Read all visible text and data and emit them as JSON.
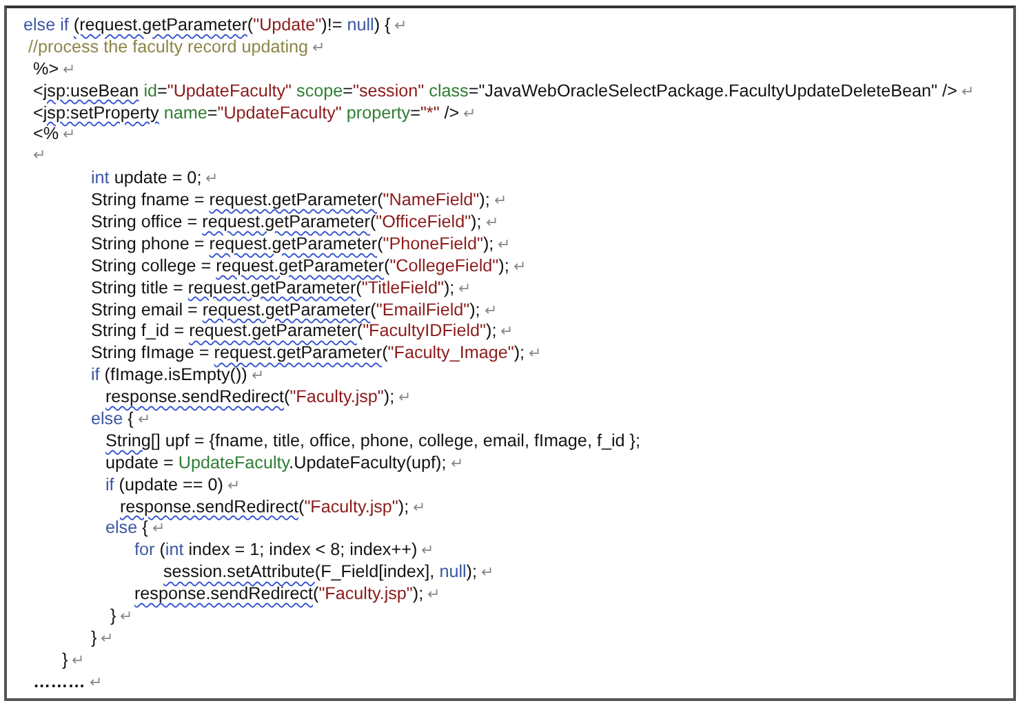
{
  "document": {
    "lines": [
      {
        "tokens": [
          {
            "text": "else if ",
            "kind": "keyword"
          },
          {
            "text": "(request.getParameter",
            "kind": "misspelled"
          },
          {
            "text": "(",
            "kind": "plain"
          },
          {
            "text": "\"Update\"",
            "kind": "string"
          },
          {
            "text": ")!= ",
            "kind": "plain"
          },
          {
            "text": "null",
            "kind": "keyword"
          },
          {
            "text": ") {",
            "kind": "plain"
          }
        ],
        "mark": "↵"
      },
      {
        "tokens": [
          {
            "text": " //process the faculty record updating",
            "kind": "comment"
          }
        ],
        "mark": "↵"
      },
      {
        "tokens": [
          {
            "text": "  %>",
            "kind": "plain"
          }
        ],
        "mark": "↵"
      },
      {
        "tokens": [
          {
            "text": "  <",
            "kind": "plain"
          },
          {
            "text": "jsp:useBean",
            "kind": "misspelled"
          },
          {
            "text": " id",
            "kind": "attr"
          },
          {
            "text": "=",
            "kind": "plain"
          },
          {
            "text": "\"UpdateFaculty\"",
            "kind": "string"
          },
          {
            "text": " scope",
            "kind": "attr"
          },
          {
            "text": "=",
            "kind": "plain"
          },
          {
            "text": "\"session\"",
            "kind": "string"
          },
          {
            "text": " class",
            "kind": "attr"
          },
          {
            "text": "=\"JavaWebOracleSelectPackage.FacultyUpdateDeleteBean\" />",
            "kind": "plain"
          }
        ],
        "mark": "↵"
      },
      {
        "tokens": [
          {
            "text": "  <",
            "kind": "plain"
          },
          {
            "text": "jsp:setProperty",
            "kind": "misspelled"
          },
          {
            "text": " name",
            "kind": "attr"
          },
          {
            "text": "=",
            "kind": "plain"
          },
          {
            "text": "\"UpdateFaculty\"",
            "kind": "string"
          },
          {
            "text": " property",
            "kind": "attr"
          },
          {
            "text": "=",
            "kind": "plain"
          },
          {
            "text": "\"*\"",
            "kind": "string"
          },
          {
            "text": " />",
            "kind": "plain"
          }
        ],
        "mark": "↵"
      },
      {
        "tokens": [
          {
            "text": "  <%",
            "kind": "plain"
          }
        ],
        "mark": "↵"
      },
      {
        "mark": "↵"
      },
      {
        "tokens": [
          {
            "text": "              int",
            "kind": "keyword"
          },
          {
            "text": " update = 0;",
            "kind": "plain"
          }
        ],
        "mark": "↵"
      },
      {
        "tokens": [
          {
            "text": "              String fname = ",
            "kind": "plain"
          },
          {
            "text": "request.getParameter",
            "kind": "misspelled"
          },
          {
            "text": "(",
            "kind": "plain"
          },
          {
            "text": "\"NameField\"",
            "kind": "string"
          },
          {
            "text": ");",
            "kind": "plain"
          }
        ],
        "mark": "↵"
      },
      {
        "tokens": [
          {
            "text": "              String office = ",
            "kind": "plain"
          },
          {
            "text": "request.getParameter",
            "kind": "misspelled"
          },
          {
            "text": "(",
            "kind": "plain"
          },
          {
            "text": "\"OfficeField\"",
            "kind": "string"
          },
          {
            "text": ");",
            "kind": "plain"
          }
        ],
        "mark": "↵"
      },
      {
        "tokens": [
          {
            "text": "              String phone = ",
            "kind": "plain"
          },
          {
            "text": "request.getParameter",
            "kind": "misspelled"
          },
          {
            "text": "(",
            "kind": "plain"
          },
          {
            "text": "\"PhoneField\"",
            "kind": "string"
          },
          {
            "text": ");",
            "kind": "plain"
          }
        ],
        "mark": "↵"
      },
      {
        "tokens": [
          {
            "text": "              String college = ",
            "kind": "plain"
          },
          {
            "text": "request.getParameter",
            "kind": "misspelled"
          },
          {
            "text": "(",
            "kind": "plain"
          },
          {
            "text": "\"CollegeField\"",
            "kind": "string"
          },
          {
            "text": ");",
            "kind": "plain"
          }
        ],
        "mark": "↵"
      },
      {
        "tokens": [
          {
            "text": "              String title = ",
            "kind": "plain"
          },
          {
            "text": "request.getParameter",
            "kind": "misspelled"
          },
          {
            "text": "(",
            "kind": "plain"
          },
          {
            "text": "\"TitleField\"",
            "kind": "string"
          },
          {
            "text": ");",
            "kind": "plain"
          }
        ],
        "mark": "↵"
      },
      {
        "tokens": [
          {
            "text": "              String email = ",
            "kind": "plain"
          },
          {
            "text": "request.getParameter",
            "kind": "misspelled"
          },
          {
            "text": "(",
            "kind": "plain"
          },
          {
            "text": "\"EmailField\"",
            "kind": "string"
          },
          {
            "text": ");",
            "kind": "plain"
          }
        ],
        "mark": "↵"
      },
      {
        "tokens": [
          {
            "text": "              String f_id = ",
            "kind": "plain"
          },
          {
            "text": "request.getParameter",
            "kind": "misspelled"
          },
          {
            "text": "(",
            "kind": "plain"
          },
          {
            "text": "\"FacultyIDField\"",
            "kind": "string"
          },
          {
            "text": ");",
            "kind": "plain"
          }
        ],
        "mark": "↵"
      },
      {
        "tokens": [
          {
            "text": "              String fImage = ",
            "kind": "plain"
          },
          {
            "text": "request.getParameter",
            "kind": "misspelled"
          },
          {
            "text": "(",
            "kind": "plain"
          },
          {
            "text": "\"Faculty_Image\"",
            "kind": "string"
          },
          {
            "text": ");",
            "kind": "plain"
          }
        ],
        "mark": "↵"
      },
      {
        "tokens": [
          {
            "text": "              if",
            "kind": "keyword"
          },
          {
            "text": " (fImage.isEmpty())",
            "kind": "plain"
          }
        ],
        "mark": "↵"
      },
      {
        "tokens": [
          {
            "text": "                 response.sendRedirect",
            "kind": "misspelled"
          },
          {
            "text": "(",
            "kind": "plain"
          },
          {
            "text": "\"Faculty.jsp\"",
            "kind": "string"
          },
          {
            "text": ");",
            "kind": "plain"
          }
        ],
        "mark": "↵"
      },
      {
        "tokens": [
          {
            "text": "              else",
            "kind": "keyword"
          },
          {
            "text": " {",
            "kind": "plain"
          }
        ],
        "mark": "↵"
      },
      {
        "tokens": [
          {
            "text": "                 String[]",
            "kind": "misspelled"
          },
          {
            "text": " upf = {fname, title, office, phone, college, email, fImage, f_id };",
            "kind": "plain"
          }
        ]
      },
      {
        "tokens": [
          {
            "text": "                 update = ",
            "kind": "plain"
          },
          {
            "text": "UpdateFaculty",
            "kind": "attr"
          },
          {
            "text": ".UpdateFaculty(upf);",
            "kind": "plain"
          }
        ],
        "mark": "↵"
      },
      {
        "tokens": [
          {
            "text": "                 if",
            "kind": "keyword"
          },
          {
            "text": " (update == 0)",
            "kind": "plain"
          }
        ],
        "mark": "↵"
      },
      {
        "tokens": [
          {
            "text": "                    response.sendRedirect",
            "kind": "misspelled"
          },
          {
            "text": "(",
            "kind": "plain"
          },
          {
            "text": "\"Faculty.jsp\"",
            "kind": "string"
          },
          {
            "text": ");",
            "kind": "plain"
          }
        ],
        "mark": "↵"
      },
      {
        "tokens": [
          {
            "text": "                 else",
            "kind": "keyword"
          },
          {
            "text": " {",
            "kind": "plain"
          }
        ],
        "mark": "↵"
      },
      {
        "tokens": [
          {
            "text": "                       for",
            "kind": "keyword"
          },
          {
            "text": " (",
            "kind": "plain"
          },
          {
            "text": "int",
            "kind": "keyword"
          },
          {
            "text": " index = 1; index < 8; index++)",
            "kind": "plain"
          }
        ],
        "mark": "↵"
      },
      {
        "tokens": [
          {
            "text": "                             session.setAttribute",
            "kind": "misspelled"
          },
          {
            "text": "(F_Field[index], ",
            "kind": "plain"
          },
          {
            "text": "null",
            "kind": "keyword"
          },
          {
            "text": ");",
            "kind": "plain"
          }
        ],
        "mark": "↵"
      },
      {
        "tokens": [
          {
            "text": "                       response.sendRedirect",
            "kind": "misspelled"
          },
          {
            "text": "(",
            "kind": "plain"
          },
          {
            "text": "\"Faculty.jsp\"",
            "kind": "string"
          },
          {
            "text": ");",
            "kind": "plain"
          }
        ],
        "mark": "↵"
      },
      {
        "tokens": [
          {
            "text": "                  }",
            "kind": "plain"
          }
        ],
        "mark": "↵"
      },
      {
        "tokens": [
          {
            "text": "              }",
            "kind": "plain"
          }
        ],
        "mark": "↵"
      },
      {
        "tokens": [
          {
            "text": "        }",
            "kind": "plain"
          }
        ],
        "mark": "↵"
      },
      {
        "tokens": [
          {
            "text": "  ………",
            "kind": "bold"
          }
        ],
        "mark": "↵"
      }
    ]
  }
}
